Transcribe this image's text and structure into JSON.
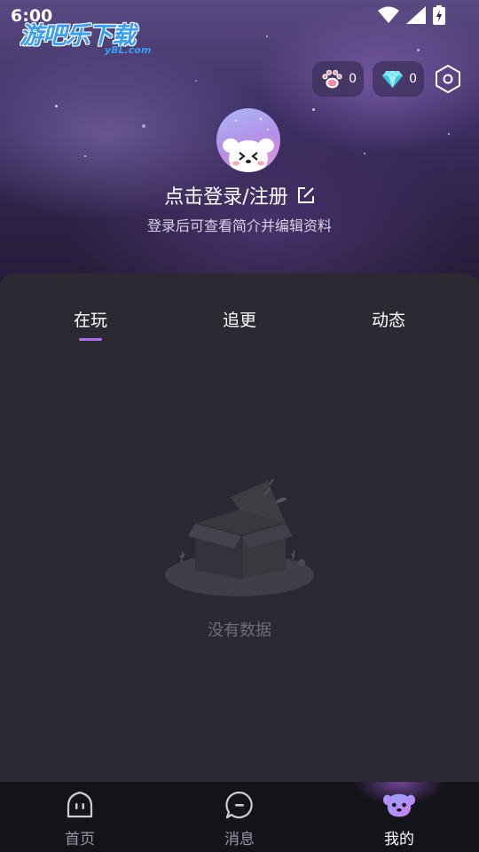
{
  "status_bar": {
    "time": "6:00"
  },
  "watermark": {
    "main": "游吧乐下载",
    "sub": "yBL.com"
  },
  "currency": {
    "paw": {
      "icon": "paw-icon",
      "value": "0"
    },
    "gem": {
      "icon": "diamond-icon",
      "value": "0"
    },
    "settings_icon": "hexagon-settings-icon"
  },
  "profile": {
    "avatar_icon": "puppy-avatar-icon",
    "login_label": "点击登录/注册",
    "edit_icon": "edit-icon",
    "subtitle": "登录后可查看简介并编辑资料"
  },
  "tabs": [
    {
      "label": "在玩",
      "active": true
    },
    {
      "label": "追更",
      "active": false
    },
    {
      "label": "动态",
      "active": false
    }
  ],
  "empty_state": {
    "icon": "empty-box-icon",
    "text": "没有数据"
  },
  "bottom_nav": [
    {
      "label": "首页",
      "icon": "home-icon",
      "active": false
    },
    {
      "label": "消息",
      "icon": "message-icon",
      "active": false
    },
    {
      "label": "我的",
      "icon": "profile-dog-icon",
      "active": true
    }
  ],
  "colors": {
    "accent": "#b36cf0",
    "panel": "#2b2932",
    "nav_bg": "#15141a"
  }
}
